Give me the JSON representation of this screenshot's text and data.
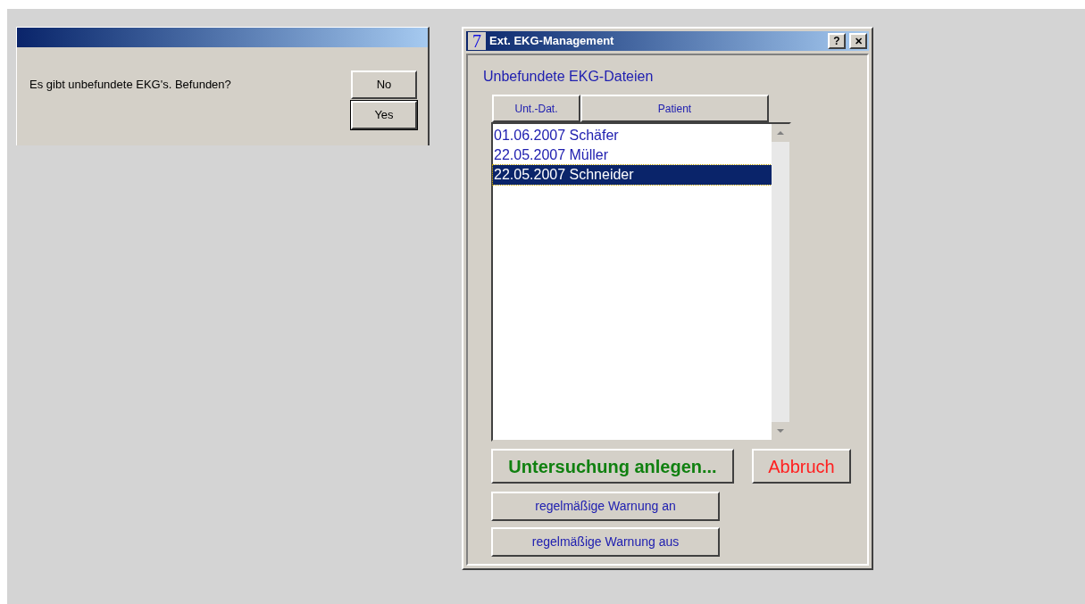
{
  "message_box": {
    "message": "Es gibt unbefundete EKG's. Befunden?",
    "buttons": [
      {
        "label": "No",
        "default": false
      },
      {
        "label": "Yes",
        "default": true
      }
    ]
  },
  "window": {
    "icon_text": "7",
    "title": "Ext. EKG-Management",
    "help_button": "?",
    "close_button": "✕"
  },
  "section_title": "Unbefundete EKG-Dateien",
  "list": {
    "columns": [
      "Unt.-Dat.",
      "Patient"
    ],
    "rows": [
      {
        "text": "01.06.2007 Schäfer",
        "selected": false
      },
      {
        "text": "22.05.2007 Müller",
        "selected": false
      },
      {
        "text": "22.05.2007 Schneider",
        "selected": true
      }
    ]
  },
  "actions": [
    {
      "label": "Untersuchung anlegen...",
      "kind": "primary"
    },
    {
      "label": "Abbruch",
      "kind": "cancel"
    }
  ],
  "warning_buttons": [
    "regelmäßige Warnung an",
    "regelmäßige Warnung aus"
  ]
}
